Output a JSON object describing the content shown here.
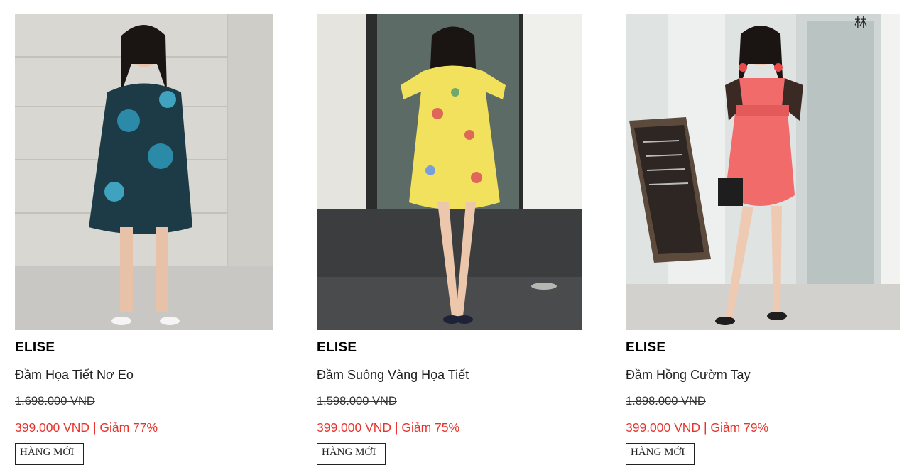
{
  "products": [
    {
      "brand": "ELISE",
      "name": "Đầm Họa Tiết Nơ Eo",
      "old_price": "1.698.000 VND",
      "sale_price": "399.000 VND",
      "separator": " | ",
      "discount": "Giảm 77%",
      "badge": "HÀNG MỚI",
      "photo_colors": {
        "wall": "#d9d7d2",
        "dress": "#1d3b47",
        "accent": "#2a8aa8",
        "skin": "#e8c2a8"
      }
    },
    {
      "brand": "ELISE",
      "name": "Đầm Suông Vàng Họa Tiết",
      "old_price": "1.598.000 VND",
      "sale_price": "399.000 VND",
      "separator": " | ",
      "discount": "Giảm 75%",
      "badge": "HÀNG MỚI",
      "photo_colors": {
        "wall": "#e6e4df",
        "dress": "#f1e15c",
        "accent": "#e0665c",
        "skin": "#ecc7ab"
      }
    },
    {
      "brand": "ELISE",
      "name": "Đầm Hồng Cườm Tay",
      "old_price": "1.898.000 VND",
      "sale_price": "399.000 VND",
      "separator": " | ",
      "discount": "Giảm 79%",
      "badge": "HÀNG MỚI",
      "photo_colors": {
        "wall": "#dfe3e2",
        "dress": "#f26b6b",
        "accent": "#3b2a24",
        "skin": "#efcab2"
      }
    }
  ]
}
